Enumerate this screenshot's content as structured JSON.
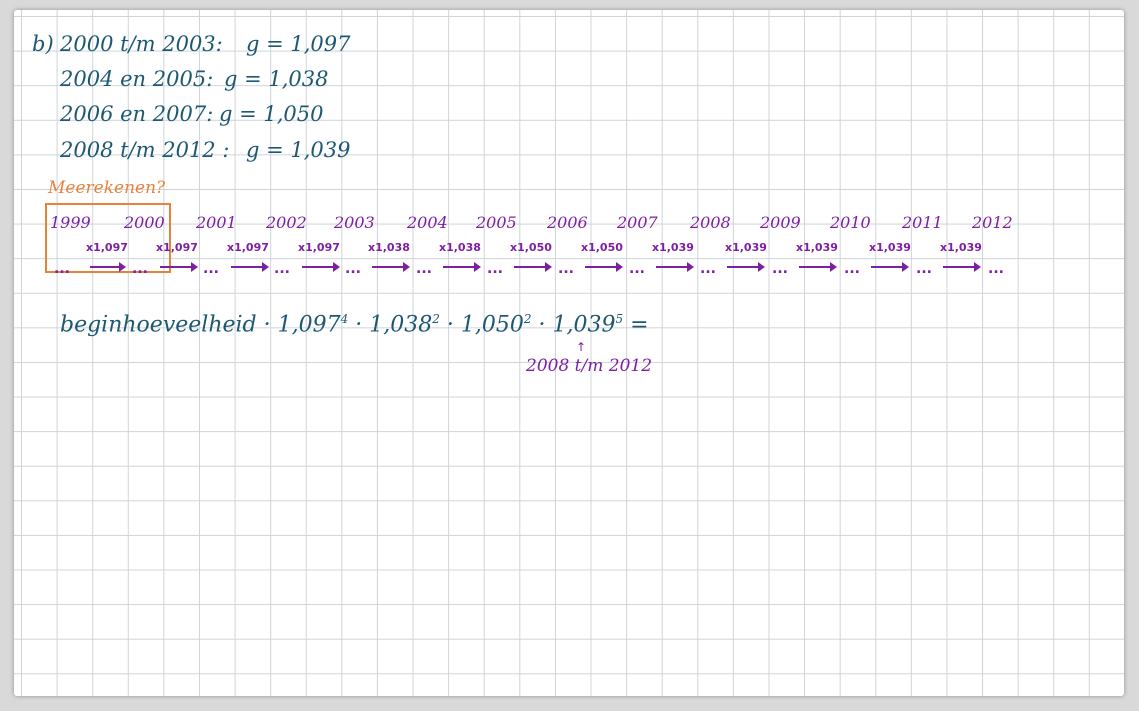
{
  "part_label": "b)",
  "lines": [
    {
      "period": "2000 t/m 2003:",
      "eq": "g = 1,097"
    },
    {
      "period": "2004 en 2005:",
      "eq": "g = 1,038"
    },
    {
      "period": "2006 en 2007:",
      "eq": "g = 1,050"
    },
    {
      "period": "2008 t/m 2012 :",
      "eq": "g = 1,039"
    }
  ],
  "note": "Meerekenen?",
  "years": [
    "1999",
    "2000",
    "2001",
    "2002",
    "2003",
    "2004",
    "2005",
    "2006",
    "2007",
    "2008",
    "2009",
    "2010",
    "2011",
    "2012"
  ],
  "factors": [
    "x1,097",
    "x1,097",
    "x1,097",
    "x1,097",
    "x1,038",
    "x1,038",
    "x1,050",
    "x1,050",
    "x1,039",
    "x1,039",
    "x1,039",
    "x1,039",
    "x1,039"
  ],
  "dots": "...",
  "formula": {
    "start": "beginhoeveelheid ·",
    "t1": "1,097",
    "e1": "4",
    "t2": "· 1,038",
    "e2": "2",
    "t3": "· 1,050",
    "e3": "2",
    "t4": "· 1,039",
    "e4": "5",
    "eq": "="
  },
  "annotation": "2008 t/m 2012",
  "colors": {
    "teal": "#1d5873",
    "orange": "#e8823a",
    "purple": "#7d1fa3"
  }
}
